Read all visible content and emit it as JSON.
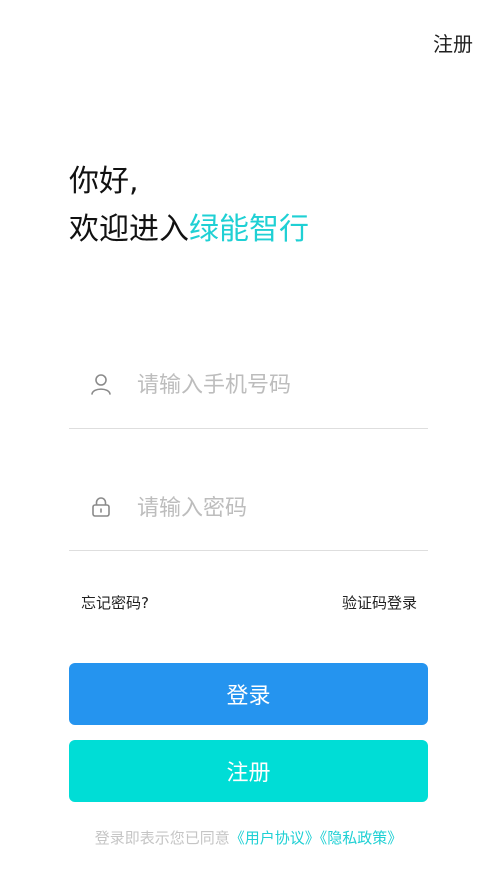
{
  "header": {
    "register_link": "注册"
  },
  "greeting": {
    "line1": "你好,",
    "line2_prefix": "欢迎进入",
    "brand": "绿能智行"
  },
  "form": {
    "phone_placeholder": "请输入手机号码",
    "password_placeholder": "请输入密码",
    "phone_icon": "user-icon",
    "password_icon": "lock-icon"
  },
  "links": {
    "forgot_password": "忘记密码?",
    "sms_login": "验证码登录"
  },
  "buttons": {
    "login": "登录",
    "register": "注册"
  },
  "agreement": {
    "prefix": "登录即表示您已同意",
    "user_agreement": "《用户协议》",
    "privacy_policy": "《隐私政策》"
  },
  "colors": {
    "brand_accent": "#1fd0d4",
    "login_button": "#2594ef",
    "register_button": "#00ddd6"
  }
}
